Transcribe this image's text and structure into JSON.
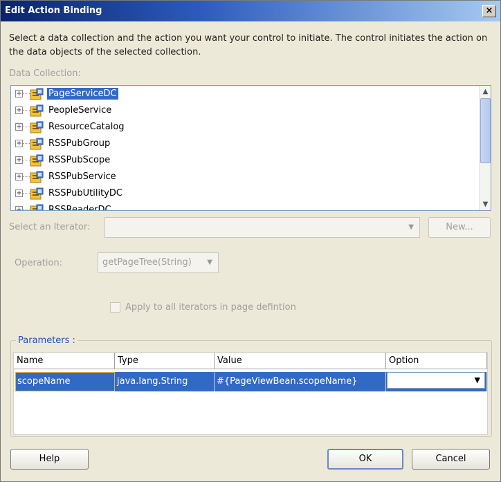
{
  "dialog": {
    "title": "Edit Action Binding",
    "close_label": "×",
    "description": "Select a data collection and the action you want your control to initiate. The control initiates the action on the data objects of the selected collection."
  },
  "data_collection": {
    "label": "Data Collection:",
    "items": [
      {
        "label": "PageServiceDC",
        "selected": true
      },
      {
        "label": "PeopleService",
        "selected": false
      },
      {
        "label": "ResourceCatalog",
        "selected": false
      },
      {
        "label": "RSSPubGroup",
        "selected": false
      },
      {
        "label": "RSSPubScope",
        "selected": false
      },
      {
        "label": "RSSPubService",
        "selected": false
      },
      {
        "label": "RSSPubUtilityDC",
        "selected": false
      },
      {
        "label": "RSSReaderDC",
        "selected": false
      }
    ],
    "expander_glyph": "+",
    "icon": "data-control-icon"
  },
  "iterator": {
    "label": "Select an Iterator:",
    "value": "",
    "new_button": "New..."
  },
  "operation": {
    "label": "Operation:",
    "value": "getPageTree(String)"
  },
  "apply_all": {
    "label": "Apply to all iterators in page defintion",
    "checked": false
  },
  "parameters": {
    "legend": "Parameters :",
    "columns": [
      "Name",
      "Type",
      "Value",
      "Option"
    ],
    "rows": [
      {
        "name": "scopeName",
        "type": "java.lang.String",
        "value": "#{PageViewBean.scopeName}",
        "option": ""
      }
    ]
  },
  "buttons": {
    "help": "Help",
    "ok": "OK",
    "cancel": "Cancel"
  },
  "colors": {
    "selection": "#316ac5",
    "legend": "#1f4fbf",
    "dialog_bg": "#ece9d8"
  }
}
